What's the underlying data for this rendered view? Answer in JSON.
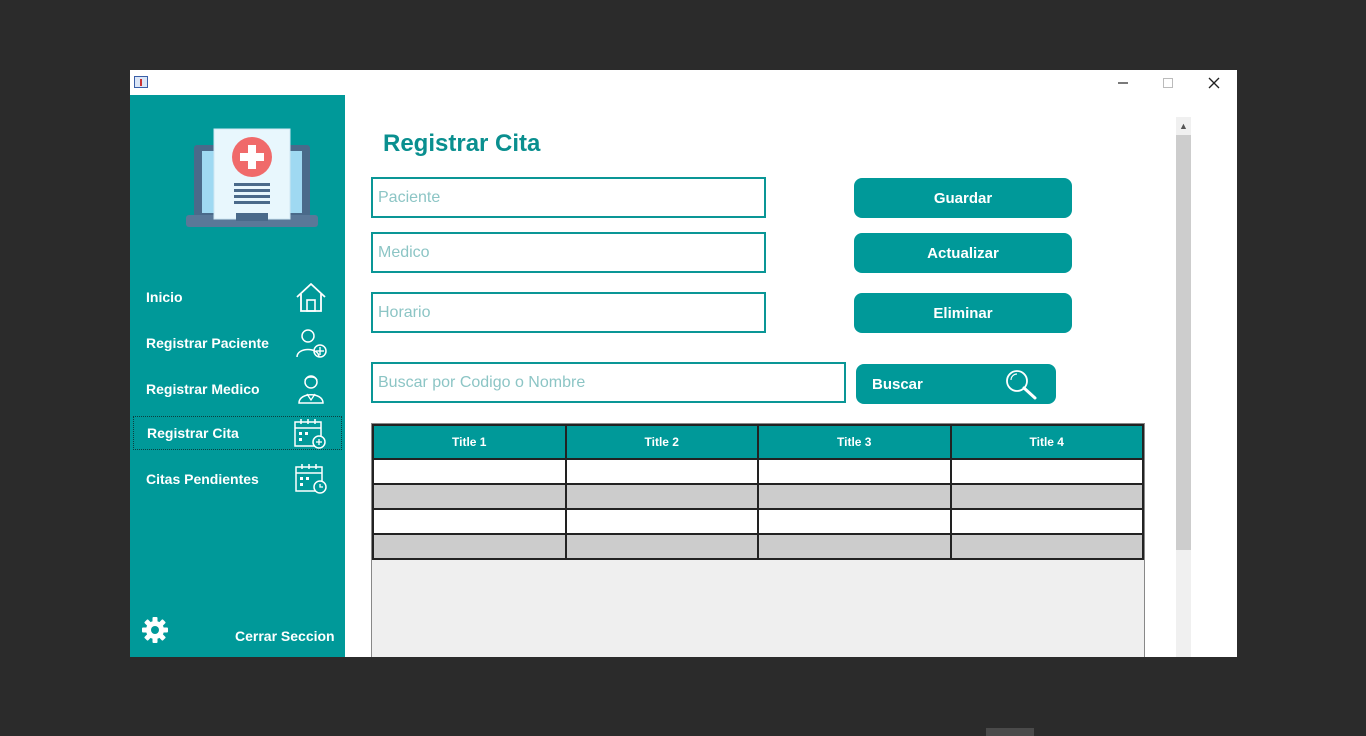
{
  "window": {
    "controls": {
      "minimize": "─",
      "maximize": "☐",
      "close": "✕"
    }
  },
  "sidebar": {
    "items": [
      {
        "label": "Inicio",
        "icon": "home-icon"
      },
      {
        "label": "Registrar Paciente",
        "icon": "add-patient-icon"
      },
      {
        "label": "Registrar Medico",
        "icon": "doctor-icon"
      },
      {
        "label": "Registrar Cita",
        "icon": "calendar-add-icon",
        "active": true
      },
      {
        "label": "Citas Pendientes",
        "icon": "calendar-clock-icon"
      }
    ],
    "settings_icon": "gear-icon",
    "logout_label": "Cerrar Seccion"
  },
  "main": {
    "title": "Registrar Cita",
    "fields": {
      "paciente": {
        "placeholder": "Paciente",
        "value": ""
      },
      "medico": {
        "placeholder": "Medico",
        "value": ""
      },
      "horario": {
        "placeholder": "Horario",
        "value": ""
      },
      "buscar": {
        "placeholder": "Buscar por Codigo o Nombre",
        "value": ""
      }
    },
    "buttons": {
      "guardar": "Guardar",
      "actualizar": "Actualizar",
      "eliminar": "Eliminar",
      "buscar": "Buscar"
    },
    "table": {
      "columns": [
        "Title 1",
        "Title 2",
        "Title 3",
        "Title 4"
      ],
      "rows": [
        [
          "",
          "",
          "",
          ""
        ],
        [
          "",
          "",
          "",
          ""
        ],
        [
          "",
          "",
          "",
          ""
        ],
        [
          "",
          "",
          "",
          ""
        ]
      ]
    }
  },
  "colors": {
    "accent": "#009999",
    "title": "#0a8f8f",
    "row_alt": "#cccccc",
    "desktop": "#2b2b2b"
  }
}
